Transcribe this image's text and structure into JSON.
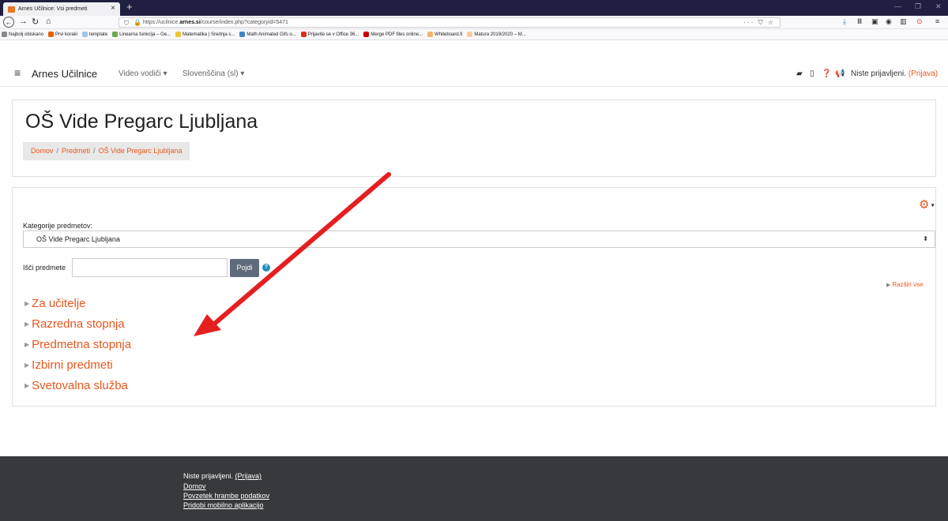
{
  "browser": {
    "tab_title": "Arnes Učilnice: Vsi predmeti",
    "url_prefix": "https://ucilnice.",
    "url_domain": "arnes.si",
    "url_path": "/course/index.php?categoryid=5471",
    "url_right": "··· ⛉ ☆",
    "bookmarks": [
      {
        "label": "Najbolj obiskano",
        "color": "#888888"
      },
      {
        "label": "Prvi koraki",
        "color": "#e66000"
      },
      {
        "label": "template",
        "color": "#9fc5e8"
      },
      {
        "label": "Linearna funkcija – Ge...",
        "color": "#6aa84f"
      },
      {
        "label": "Matematika | Srednja s...",
        "color": "#f1c232"
      },
      {
        "label": "Math Animated Gifs o...",
        "color": "#3d85c6"
      },
      {
        "label": "Prijavite se v Office 36...",
        "color": "#e0301e"
      },
      {
        "label": "Merge PDF files online...",
        "color": "#cc0000"
      },
      {
        "label": "Whiteboard.fi",
        "color": "#f6b26b"
      },
      {
        "label": "Matura 2019/2020 – M...",
        "color": "#f9cb9c"
      }
    ]
  },
  "header": {
    "brand": "Arnes Učilnice",
    "video_guides": "Video vodiči ▾",
    "language": "Slovenščina (sl) ▾",
    "not_logged_in": "Niste prijavljeni.",
    "login_link": "(Prijava)"
  },
  "page": {
    "title": "OŠ Vide Pregarc Ljubljana",
    "breadcrumb": [
      "Domov",
      "Predmeti",
      "OŠ Vide Pregarc Ljubljana"
    ]
  },
  "main": {
    "category_label": "Kategorije predmetov:",
    "category_selected": "OŠ Vide Pregarc Ljubljana",
    "search_label": "Išči predmete",
    "search_value": "",
    "go_button": "Pojdi",
    "expand_all": "Razširi vse",
    "categories": [
      "Za učitelje",
      "Razredna stopnja",
      "Predmetna stopnja",
      "Izbirni predmeti",
      "Svetovalna služba"
    ]
  },
  "footer": {
    "not_logged_in": "Niste prijavljeni.",
    "login_link": "(Prijava)",
    "links": [
      "Domov",
      "Povzetek hrambe podatkov",
      "Pridobi mobilno aplikacijo"
    ]
  },
  "colors": {
    "accent": "#e8571e",
    "arrow": "#e51f1f",
    "footer_bg": "#373a3c"
  }
}
